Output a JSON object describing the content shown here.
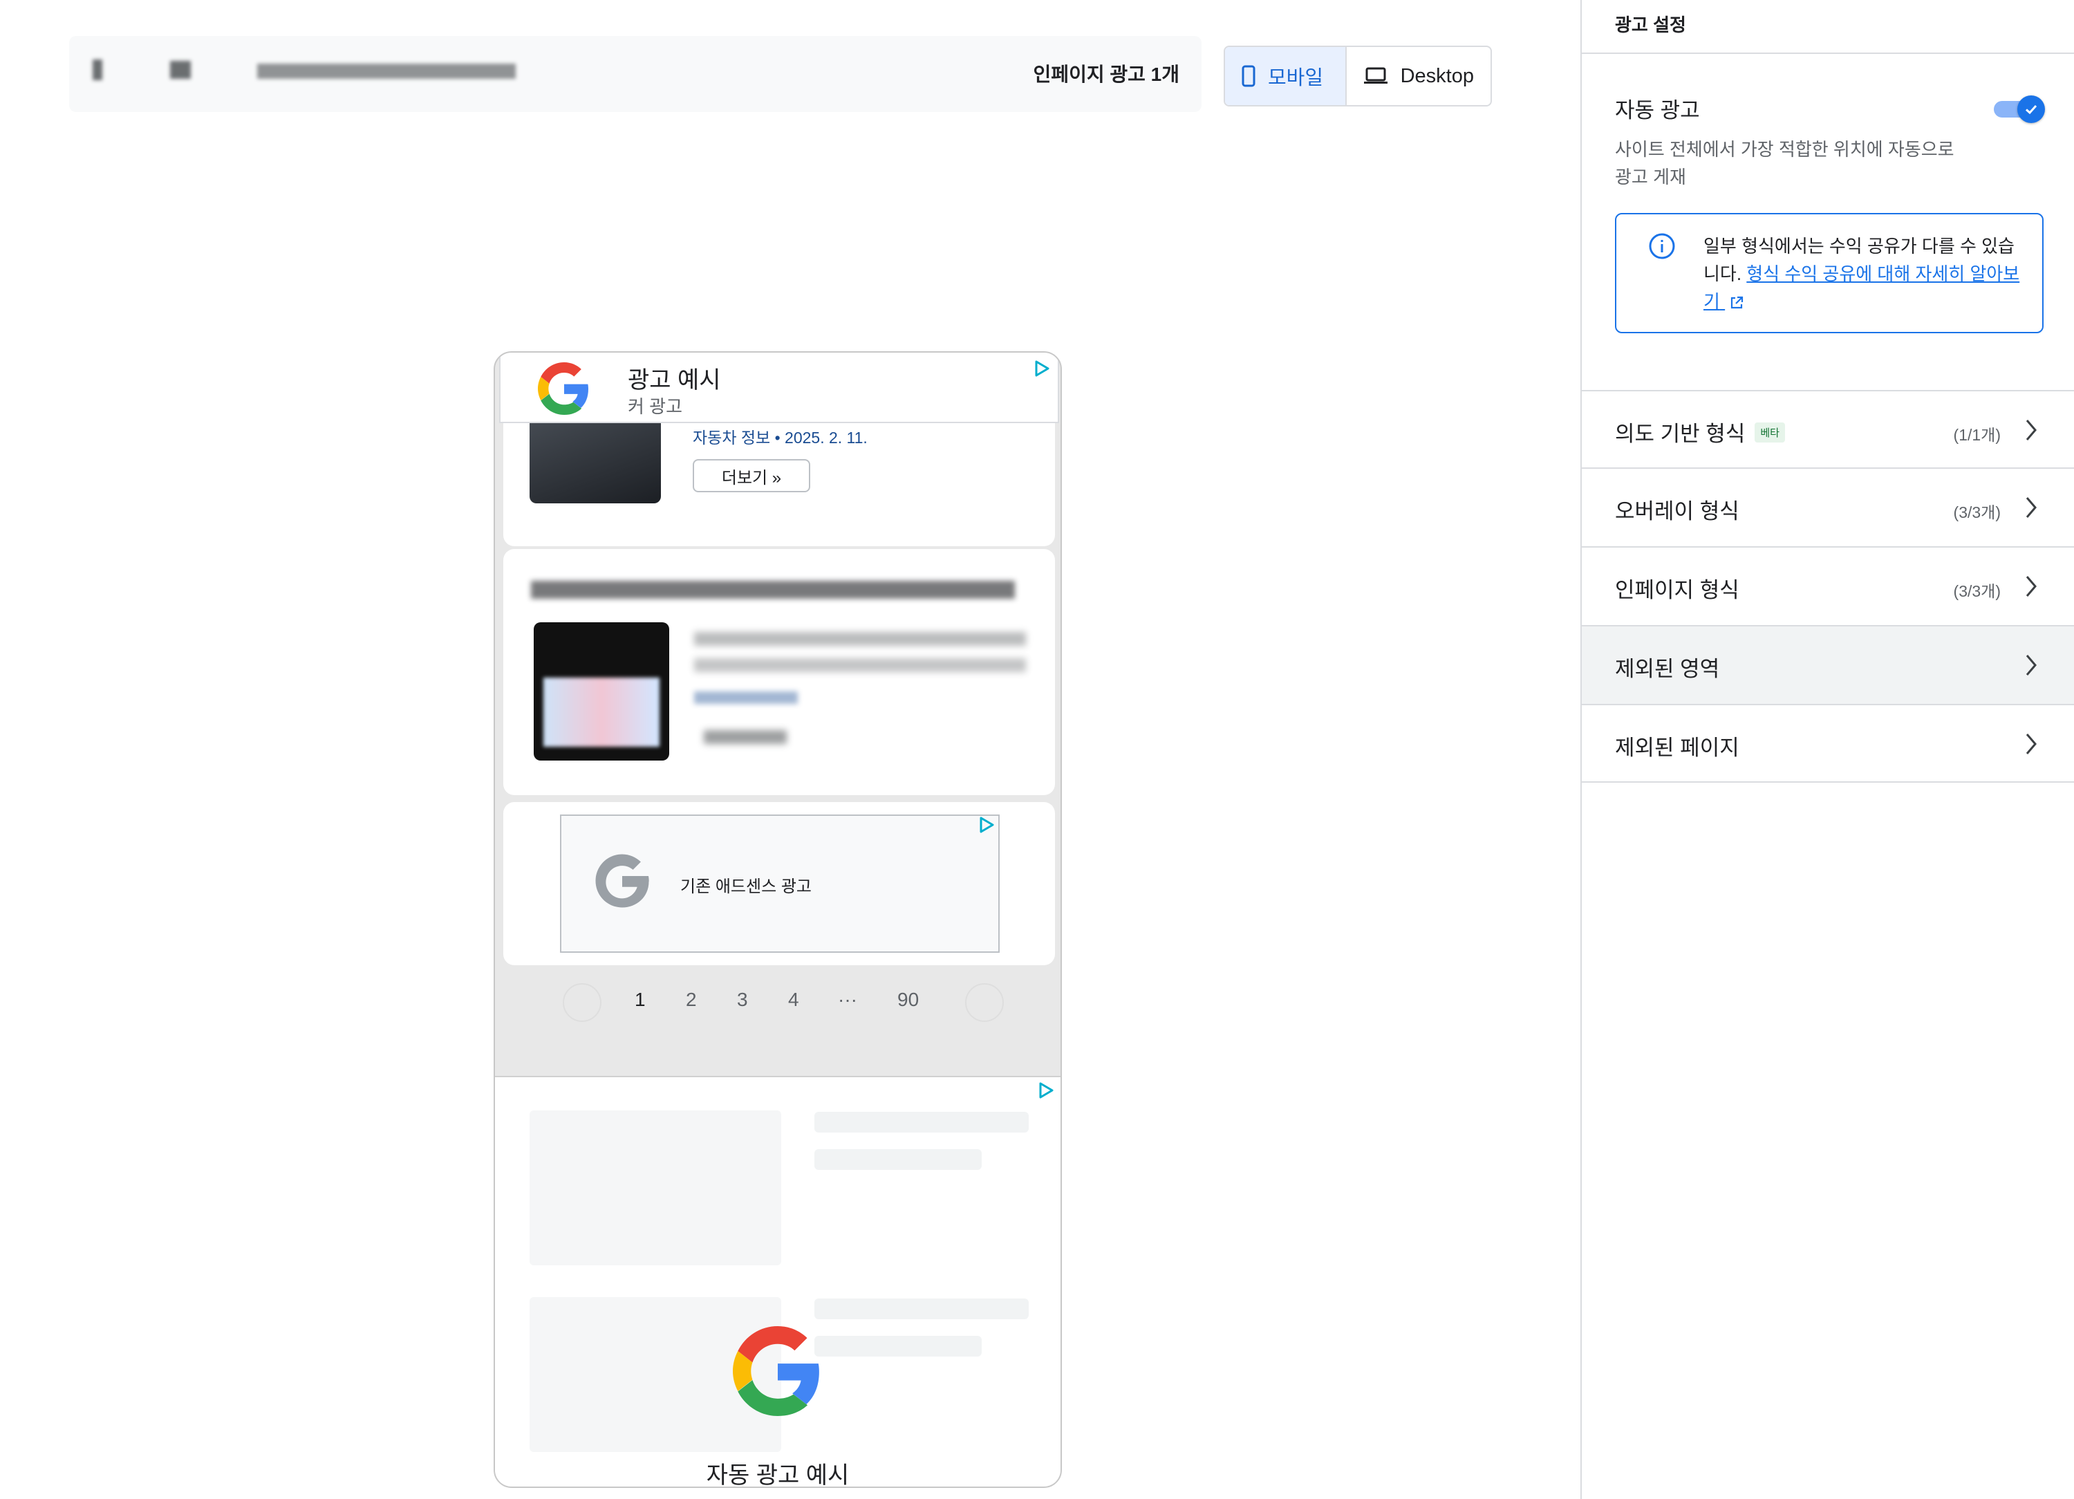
{
  "toolbar": {
    "page_ad_count": "인페이지 광고 1개",
    "mobile_label": "모바일",
    "desktop_label": "Desktop"
  },
  "preview": {
    "anchor_ad": {
      "title": "광고 예시",
      "subtitle": "커 광고"
    },
    "post": {
      "category_date": "자동차 정보  •  2025. 2. 11.",
      "more_button": "더보기 »"
    },
    "legacy_ad": {
      "label": "기존 애드센스 광고"
    },
    "pagination": {
      "pages": [
        "1",
        "2",
        "3",
        "4",
        "···",
        "90"
      ],
      "current": "1"
    },
    "auto_ad": {
      "title": "자동 광고 예시"
    }
  },
  "panel": {
    "title": "광고 설정",
    "auto_ads": {
      "label": "자동 광고",
      "description": "사이트 전체에서 가장 적합한 위치에 자동으로 광고 게재",
      "enabled": true
    },
    "info": {
      "text": "일부 형식에서는 수익 공유가 다를 수 있습니다. ",
      "link": "형식 수익 공유에 대해 자세히 알아보기"
    },
    "rows": [
      {
        "label": "의도 기반 형식",
        "badge": "베타",
        "count": "(1/1개)"
      },
      {
        "label": "오버레이 형식",
        "count": "(3/3개)"
      },
      {
        "label": "인페이지 형식",
        "count": "(3/3개)"
      },
      {
        "label": "제외된 영역",
        "count": ""
      },
      {
        "label": "제외된 페이지",
        "count": ""
      }
    ]
  },
  "colors": {
    "accent": "#1a73e8",
    "accent_light": "#e8f0fe",
    "selected_row": "#f1f3f4",
    "beta_bg": "#e6f4ea"
  }
}
